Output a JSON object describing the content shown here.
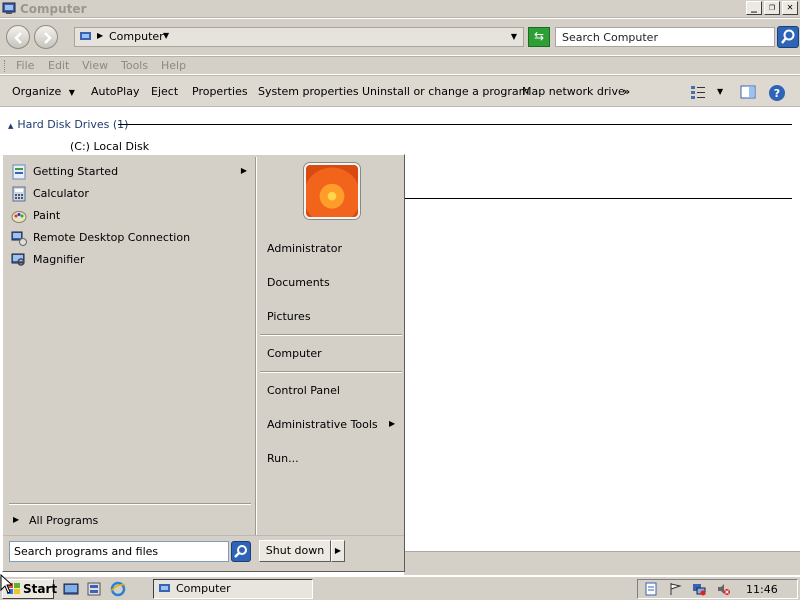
{
  "window": {
    "title": "Computer",
    "controls": [
      "_",
      "❐",
      "✕"
    ]
  },
  "address": {
    "location": "Computer",
    "search_placeholder": "Search Computer"
  },
  "menu": {
    "items": [
      "File",
      "Edit",
      "View",
      "Tools",
      "Help"
    ]
  },
  "toolbar": {
    "organize": "Organize",
    "autoplay": "AutoPlay",
    "eject": "Eject",
    "properties": "Properties",
    "system_properties": "System properties",
    "uninstall": "Uninstall or change a program",
    "map_drive": "Map network drive",
    "more": "»"
  },
  "content": {
    "group_header": "Hard Disk Drives (1)",
    "drive": "(C:) Local Disk"
  },
  "start_menu": {
    "programs": [
      {
        "label": "Getting Started",
        "icon": "getting-started-icon",
        "submenu": true
      },
      {
        "label": "Calculator",
        "icon": "calculator-icon"
      },
      {
        "label": "Paint",
        "icon": "paint-icon"
      },
      {
        "label": "Remote Desktop Connection",
        "icon": "remote-desktop-icon"
      },
      {
        "label": "Magnifier",
        "icon": "magnifier-icon"
      }
    ],
    "all_programs": "All Programs",
    "right": {
      "administrator": "Administrator",
      "documents": "Documents",
      "pictures": "Pictures",
      "computer": "Computer",
      "control_panel": "Control Panel",
      "admin_tools": "Administrative Tools",
      "run": "Run..."
    },
    "search_placeholder": "Search programs and files",
    "shutdown": "Shut down"
  },
  "taskbar": {
    "start": "Start",
    "task": "Computer",
    "clock": "11:46"
  }
}
